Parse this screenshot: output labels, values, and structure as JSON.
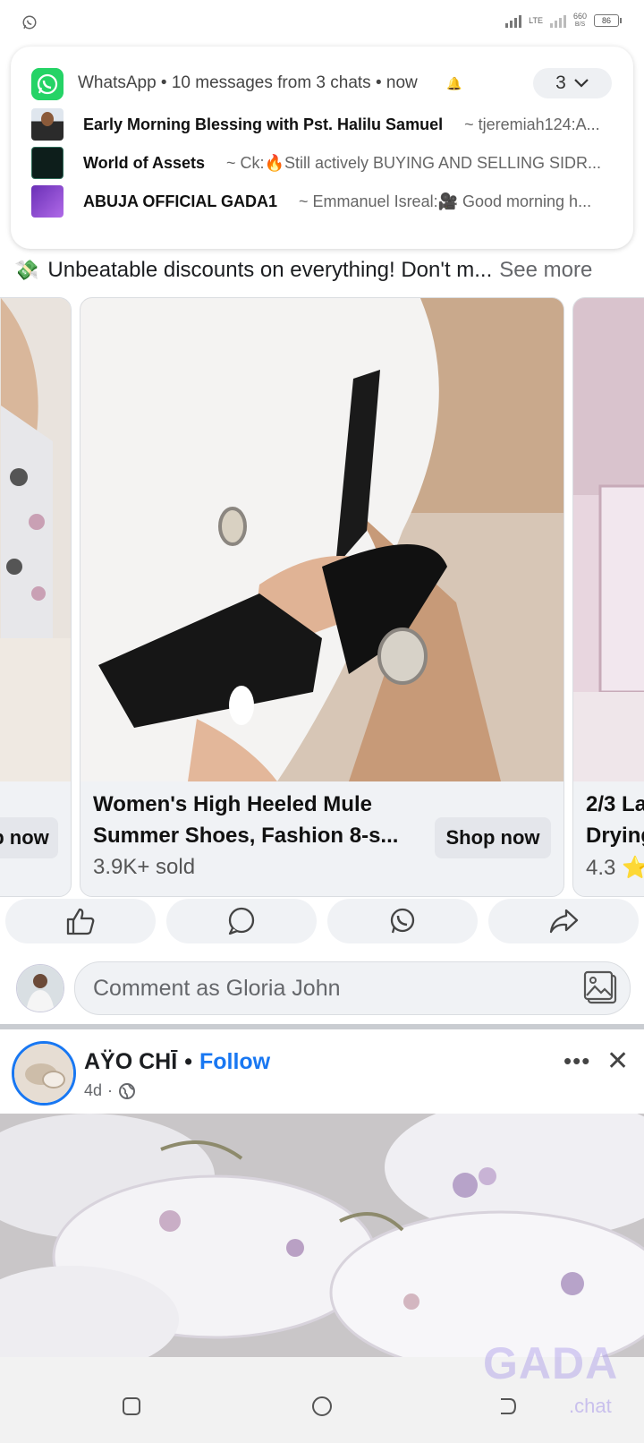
{
  "status_bar": {
    "lte": "LTE",
    "speed_value": "660",
    "speed_unit": "B/S",
    "battery": "86"
  },
  "notification": {
    "header": "WhatsApp • 10 messages from 3 chats • now",
    "count": "3",
    "chats": [
      {
        "name": "Early Morning Blessing with Pst. Halilu Samuel",
        "message": "~ tjeremiah124:A..."
      },
      {
        "name": "World of Assets",
        "message": "~ Ck:🔥Still actively BUYING AND SELLING SIDR..."
      },
      {
        "name": "ABUJA OFFICIAL GADA1",
        "message": "~ Emmanuel Isreal:🎥 Good morning h..."
      }
    ]
  },
  "promo": {
    "text": "Unbeatable discounts on everything! Don't m...",
    "see_more": "See more"
  },
  "carousel": {
    "prev_card": {
      "shop_label": "p now"
    },
    "main_card": {
      "title_line1": "Women's High Heeled Mule",
      "title_line2": "Summer Shoes, Fashion 8-s...",
      "sold": "3.9K+ sold",
      "shop_label": "Shop now"
    },
    "next_card": {
      "title_line1": "2/3 La",
      "title_line2": "Drying",
      "rating": "4.3 ⭐"
    }
  },
  "comment": {
    "placeholder": "Comment as Gloria John"
  },
  "post": {
    "author": "AŸO CHĪ",
    "follow": "Follow",
    "age": "4d",
    "separator": "•"
  },
  "watermark": {
    "brand": "GADA",
    "suffix": ".chat"
  },
  "colors": {
    "facebook_blue": "#1877f2",
    "whatsapp_green": "#25d366",
    "surface": "#f0f2f5"
  }
}
